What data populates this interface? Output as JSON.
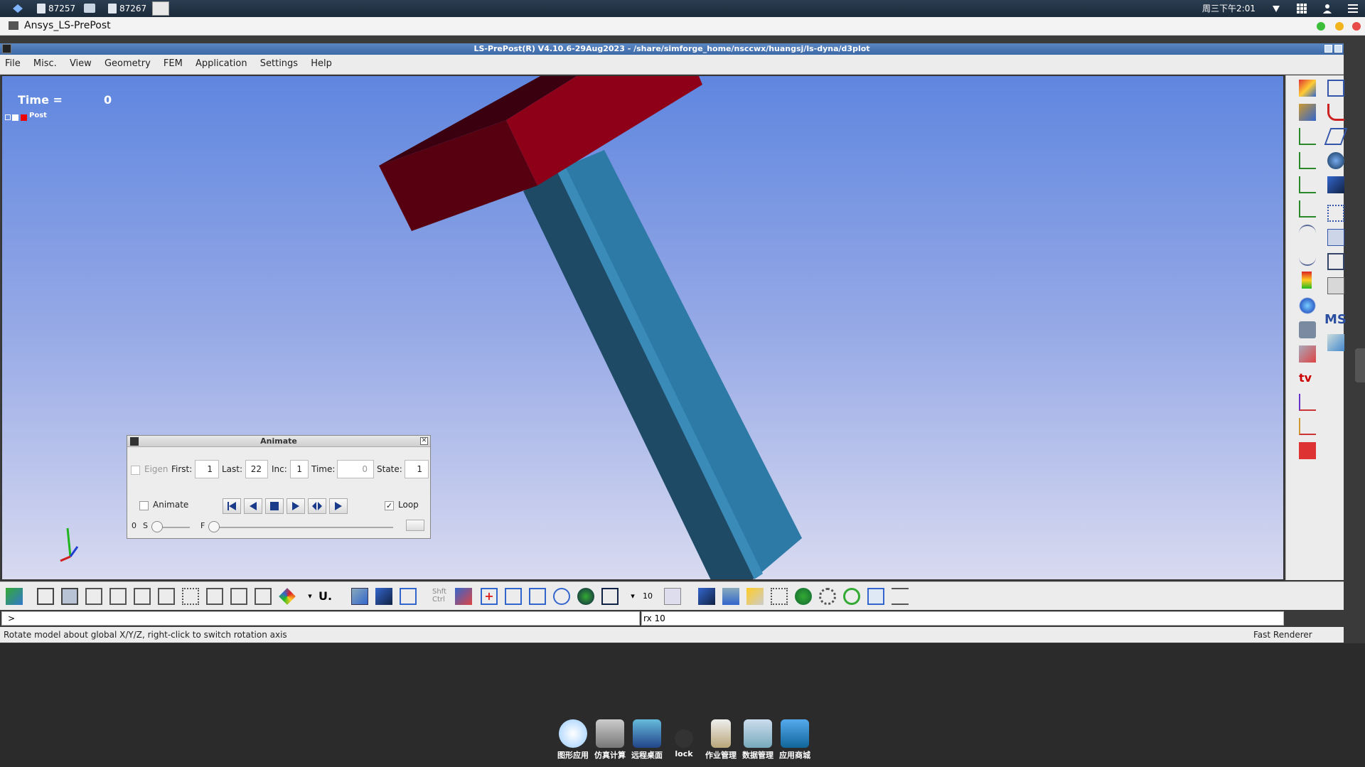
{
  "system_bar": {
    "tasks": [
      "87257",
      "87267"
    ],
    "clock": "周三下午2:01"
  },
  "app": {
    "title": "Ansys_LS-PrePost"
  },
  "window": {
    "title": "LS-PrePost(R) V4.10.6-29Aug2023 - /share/simforge_home/nsccwx/huangsj/ls-dyna/d3plot"
  },
  "menu": [
    "File",
    "Misc.",
    "View",
    "Geometry",
    "FEM",
    "Application",
    "Settings",
    "Help"
  ],
  "viewport": {
    "time_label": "Time =",
    "time_value": "0",
    "tree_label": "Post"
  },
  "right_panel": {
    "ms_label": "MS",
    "tv_label": "tv"
  },
  "animate_dialog": {
    "title": "Animate",
    "eigen_label": "Eigen",
    "first_label": "First:",
    "first_value": "1",
    "last_label": "Last:",
    "last_value": "22",
    "inc_label": "Inc:",
    "inc_value": "1",
    "time_label": "Time:",
    "time_value": "0",
    "state_label": "State:",
    "state_value": "1",
    "animate_label": "Animate",
    "loop_label": "Loop",
    "loop_checked": true,
    "slider_left_num": "0",
    "slider_s": "S",
    "slider_f": "F"
  },
  "toolbar": {
    "u_label": "U.",
    "shft_label": "Shft",
    "ctrl_label": "Ctrl",
    "num_label": "10"
  },
  "command": {
    "prompt": ">",
    "output": "rx 10"
  },
  "status": {
    "message": "Rotate model about global X/Y/Z, right-click to switch rotation axis",
    "renderer": "Fast Renderer"
  },
  "dock": [
    "图形应用",
    "仿真计算",
    "远程桌面",
    "lock",
    "作业管理",
    "数据管理",
    "应用商城"
  ],
  "colors": {
    "red_block": "#8e0018",
    "blue_bar": "#2e7aa6",
    "bg_top": "#5f86df"
  }
}
